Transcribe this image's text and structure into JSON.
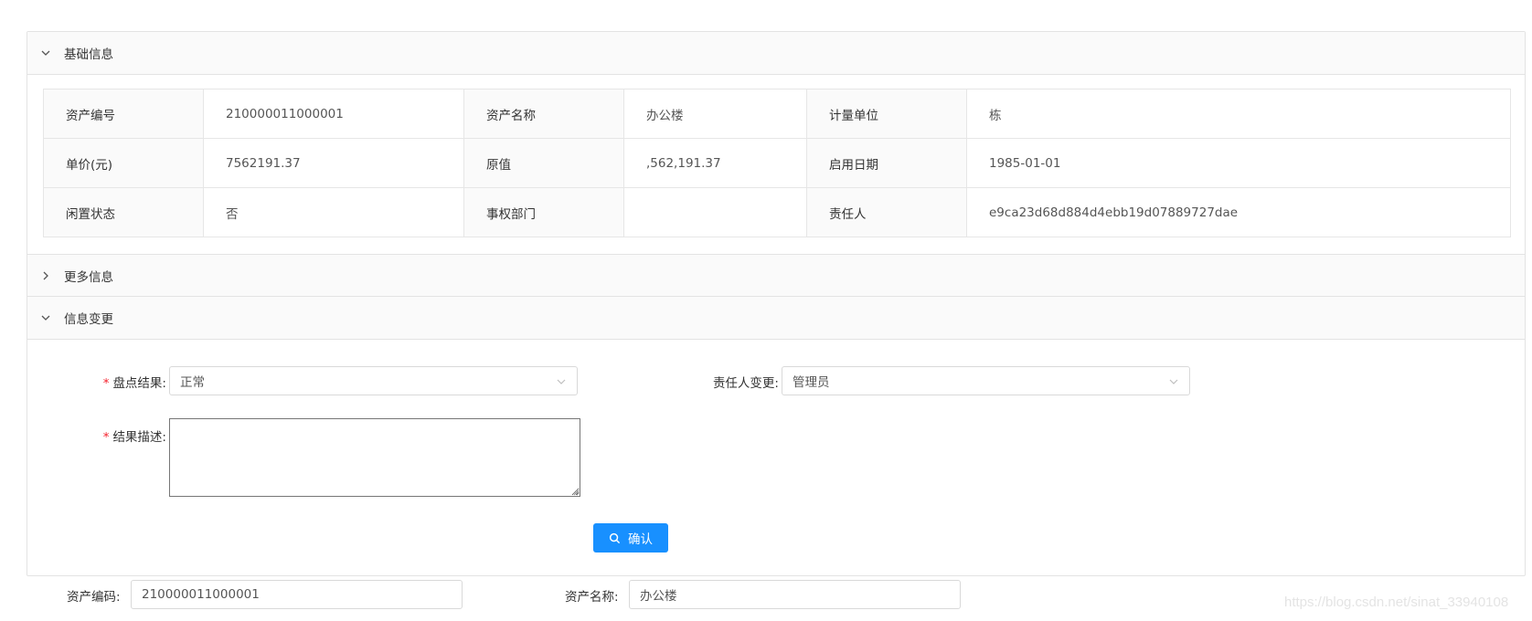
{
  "panels": {
    "basic": {
      "title": "基础信息"
    },
    "more": {
      "title": "更多信息"
    },
    "change": {
      "title": "信息变更"
    }
  },
  "basic_info": {
    "rows": [
      [
        {
          "label": "资产编号",
          "value": "210000011000001"
        },
        {
          "label": "资产名称",
          "value": "办公楼"
        },
        {
          "label": "计量单位",
          "value": "栋"
        }
      ],
      [
        {
          "label": "单价(元)",
          "value": "7562191.37"
        },
        {
          "label": "原值",
          "value": ",562,191.37"
        },
        {
          "label": "启用日期",
          "value": "1985-01-01"
        }
      ],
      [
        {
          "label": "闲置状态",
          "value": "否"
        },
        {
          "label": "事权部门",
          "value": ""
        },
        {
          "label": "责任人",
          "value": "e9ca23d68d884d4ebb19d07889727dae"
        }
      ]
    ]
  },
  "change_form": {
    "required_mark": "*",
    "result_label": "盘点结果:",
    "result_value": "正常",
    "owner_change_label": "责任人变更:",
    "owner_change_value": "管理员",
    "desc_label": "结果描述:",
    "desc_value": "",
    "confirm_label": "确认"
  },
  "bottom_form": {
    "code_label": "资产编码:",
    "code_value": "210000011000001",
    "name_label": "资产名称:",
    "name_value": "办公楼"
  },
  "icons": {
    "expanded": "chevron-down-icon",
    "collapsed": "chevron-right-icon",
    "search": "search-icon"
  },
  "colors": {
    "primary": "#1890ff",
    "required": "#f5222d"
  },
  "watermark": "https://blog.csdn.net/sinat_33940108"
}
